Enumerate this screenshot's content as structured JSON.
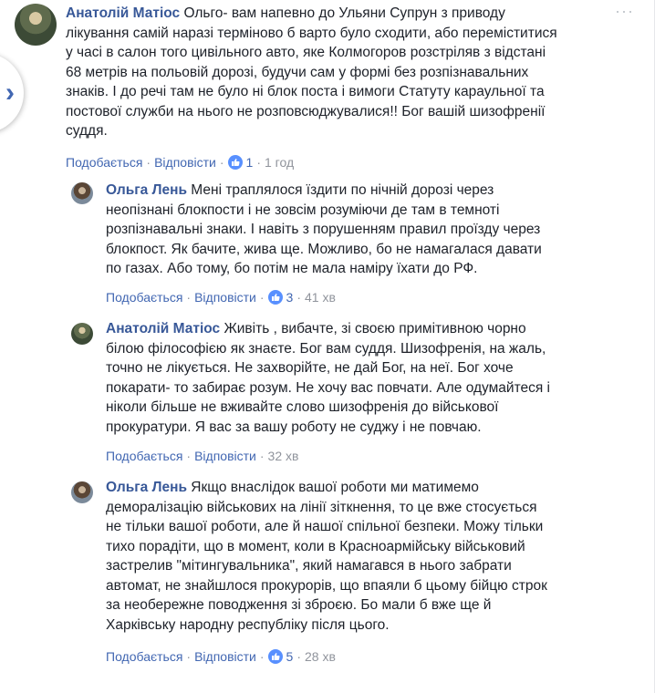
{
  "comments": [
    {
      "author": "Анатолій Матіос",
      "text_lines": [
        " Ольго- вам напевно до Ульяни Супрун з приводу",
        "лікування самій наразі терміново б варто було сходити, або переміститися",
        "у часі в салон того цивільного авто, яке Колмогоров розстріляв з відстані",
        "68 метрів на польовій дорозі, будучи сам у формі без розпізнавальних",
        "знаків. І до речі там не було ні блок поста і вимоги Статуту караульної та",
        "постової служби на нього не розповсюджувалися!! Бог вашій шизофренії",
        "суддя."
      ],
      "like_label": "Подобається",
      "reply_label": "Відповісти",
      "reactions": "1",
      "time": "1 год"
    },
    {
      "author": "Ольга Лень",
      "text_lines": [
        " Мені траплялося їздити по нічній дорозі через",
        "неопізнані блокпости і не зовсім розуміючи де там в темноті",
        "розпізнавальні знаки. І навіть з порушенням правил проїзду через",
        "блокпост. Як бачите, жива ще. Можливо, бо не намагалася давати",
        "по газах. Або тому, бо потім не мала наміру їхати до РФ."
      ],
      "like_label": "Подобається",
      "reply_label": "Відповісти",
      "reactions": "3",
      "time": "41 хв"
    },
    {
      "author": "Анатолій Матіос",
      "text_lines": [
        " Живіть , вибачте, зі своєю примітивною чорно",
        "білою філософією як знаєте. Бог вам суддя. Шизофренія, на жаль,",
        "точно не лікується. Не захворійте, не дай Бог, на неї. Бог хоче",
        "покарати- то забирає розум. Не хочу вас повчати. Але одумайтеся і",
        "ніколи більше не вживайте слово шизофренія до військової",
        "прокуратури. Я вас за вашу роботу не суджу і не повчаю."
      ],
      "like_label": "Подобається",
      "reply_label": "Відповісти",
      "reactions": "",
      "time": "32 хв"
    },
    {
      "author": "Ольга Лень",
      "text_lines": [
        " Якщо внаслідок вашої роботи ми матимемо",
        "деморалізацію військових на лінії зіткнення, то це вже стосується",
        "не тільки вашої роботи, але й нашої спільної безпеки. Можу тільки",
        "тихо порадіти, що в момент, коли в Красноармійську військовий",
        "застрелив \"мітингувальника\", який намагався в нього забрати",
        "автомат, не знайшлося прокурорів, що впаяли б цьому бійцю строк",
        "за необережне поводження зі зброєю. Бо мали б вже ще й",
        "Харківську народну республіку після цього."
      ],
      "like_label": "Подобається",
      "reply_label": "Відповісти",
      "reactions": "5",
      "time": "28 хв"
    }
  ],
  "icons": {
    "nav": "chevron-right-icon",
    "more": "more-options-icon",
    "like": "thumbs-up-icon"
  },
  "colors": {
    "author": "#385898",
    "link": "#4267b2",
    "like_badge": "#5890ff",
    "meta": "#616770"
  }
}
